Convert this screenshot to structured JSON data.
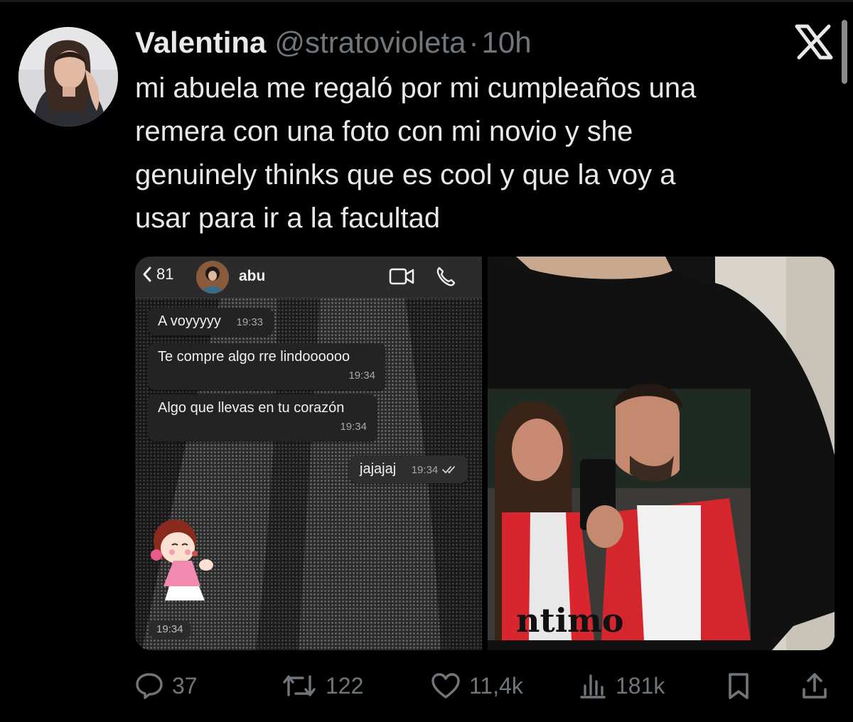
{
  "tweet": {
    "display_name": "Valentina",
    "handle": "@stratovioleta",
    "separator": "·",
    "time": "10h",
    "text": "mi abuela me regaló por mi cumpleaños una\nremera con una foto con mi novio y she\ngenuinely thinks que es cool y que la voy a\nusar para ir a la facultad"
  },
  "chat": {
    "back_count": "81",
    "contact_name": "abu",
    "messages": [
      {
        "text": "A voyyyyy",
        "time": "19:33"
      },
      {
        "text": "Te compre algo rre lindoooooo",
        "time": "19:34"
      },
      {
        "text": "Algo que llevas en tu corazón",
        "time": "19:34"
      },
      {
        "text": "jajajaj",
        "time": "19:34"
      }
    ],
    "sticker_time": "19:34"
  },
  "shirt_print_text": "ntimo",
  "actions": {
    "replies": "37",
    "reposts": "122",
    "likes": "11,4k",
    "views": "181k"
  },
  "icons": [
    "x-logo-icon",
    "chevron-left-icon",
    "video-call-icon",
    "phone-icon",
    "double-check-icon",
    "reply-icon",
    "repost-icon",
    "like-icon",
    "views-icon",
    "bookmark-icon",
    "share-icon"
  ],
  "colors": {
    "background": "#000000",
    "text": "#e7e9ea",
    "muted": "#71767b"
  }
}
